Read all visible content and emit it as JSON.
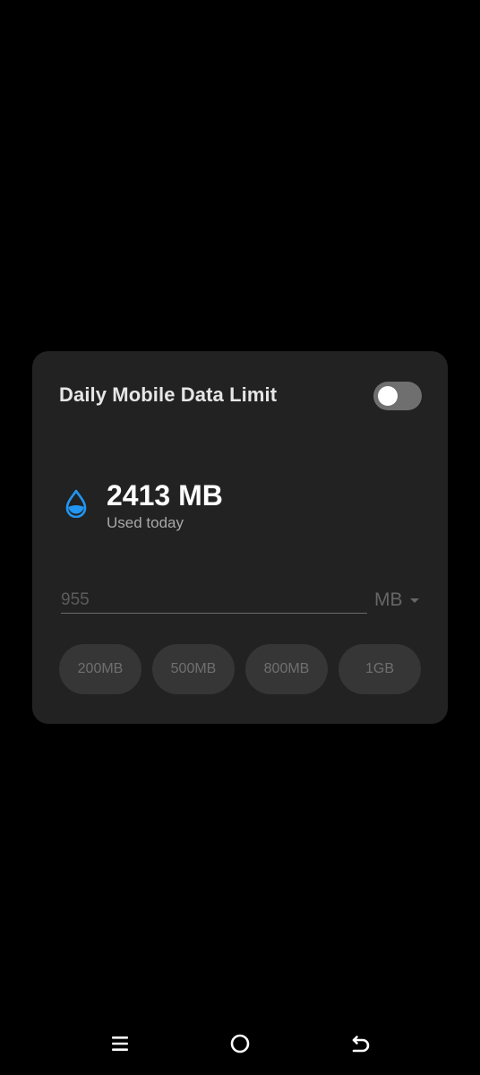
{
  "dialog": {
    "title": "Daily Mobile Data Limit",
    "toggle_on": false,
    "usage": {
      "value": "2413 MB",
      "caption": "Used today",
      "icon": "water-drop-icon"
    },
    "limit_input": {
      "placeholder": "955",
      "value": ""
    },
    "unit": {
      "selected": "MB"
    },
    "presets": [
      "200MB",
      "500MB",
      "800MB",
      "1GB"
    ]
  },
  "navbar": {
    "items": [
      "menu-icon",
      "home-icon",
      "back-icon"
    ]
  },
  "colors": {
    "background": "#000000",
    "dialog": "#222222",
    "accent": "#2196f3",
    "toggle_off": "#6f6f6f",
    "preset_bg": "#363636"
  }
}
